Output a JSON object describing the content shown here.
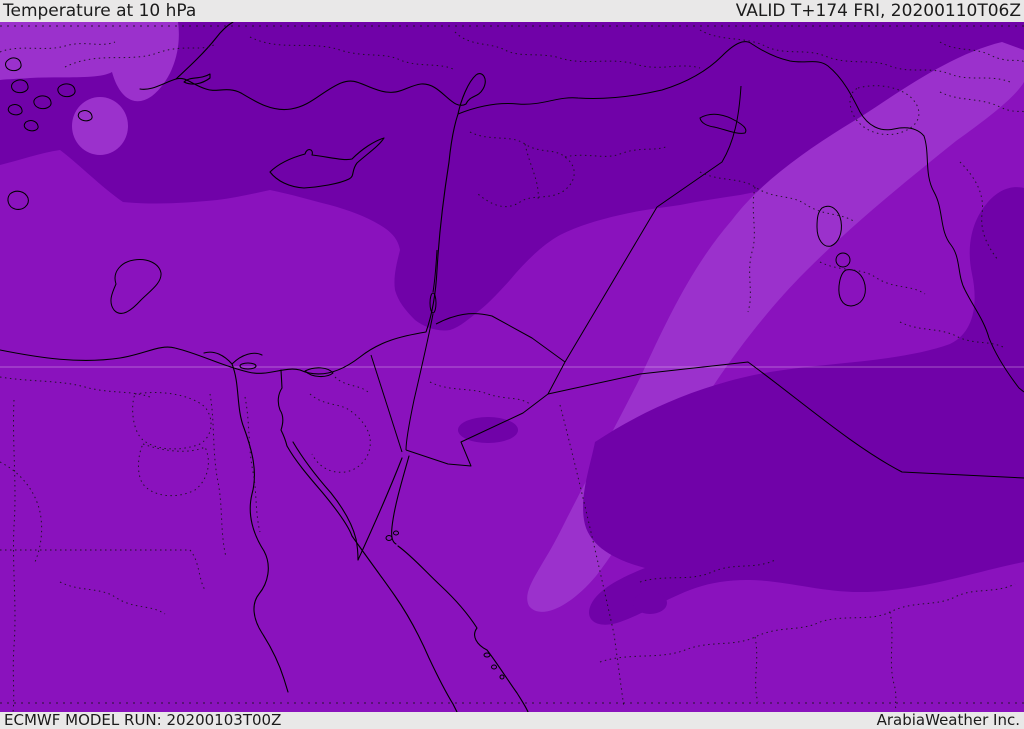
{
  "header": {
    "title": "Temperature at 10 hPa",
    "valid": "VALID T+174 FRI, 20200110T06Z"
  },
  "footer": {
    "model_run": "ECMWF MODEL RUN: 20200103T00Z",
    "credit": "ArabiaWeather Inc."
  },
  "map": {
    "description": "Temperature shading map of the Middle East / Eastern Mediterranean",
    "colors": {
      "band_dark": "#7002a8",
      "band_mid": "#8a12bd",
      "band_light": "#9b31cc",
      "line": "#000000",
      "chrome_bg": "#e9e8e8",
      "ink": "#1b1b1b"
    }
  }
}
